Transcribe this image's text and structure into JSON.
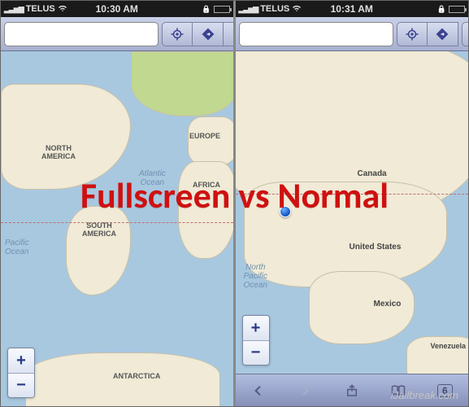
{
  "overlay": {
    "text": "Fullscreen vs Normal"
  },
  "watermark": "iJailbreak.com",
  "left": {
    "status": {
      "carrier": "TELUS",
      "time": "10:30 AM"
    },
    "search": {
      "value": "",
      "placeholder": ""
    },
    "map": {
      "labels": {
        "north_america": "NORTH\nAMERICA",
        "south_america": "SOUTH\nAMERICA",
        "europe": "EUROPE",
        "africa": "AFRICA",
        "antarctica": "ANTARCTICA",
        "atlantic": "Atlantic\nOcean",
        "pacific": "Pacific\nOcean"
      }
    },
    "zoom": {
      "in": "+",
      "out": "−"
    }
  },
  "right": {
    "status": {
      "carrier": "TELUS",
      "time": "10:31 AM"
    },
    "search": {
      "value": "",
      "placeholder": ""
    },
    "map": {
      "labels": {
        "canada": "Canada",
        "united_states": "United States",
        "mexico": "Mexico",
        "venezuela": "Venezuela",
        "north_pacific": "North\nPacific\nOcean"
      }
    },
    "zoom": {
      "in": "+",
      "out": "−"
    },
    "bottombar": {
      "tabs": "6"
    }
  }
}
